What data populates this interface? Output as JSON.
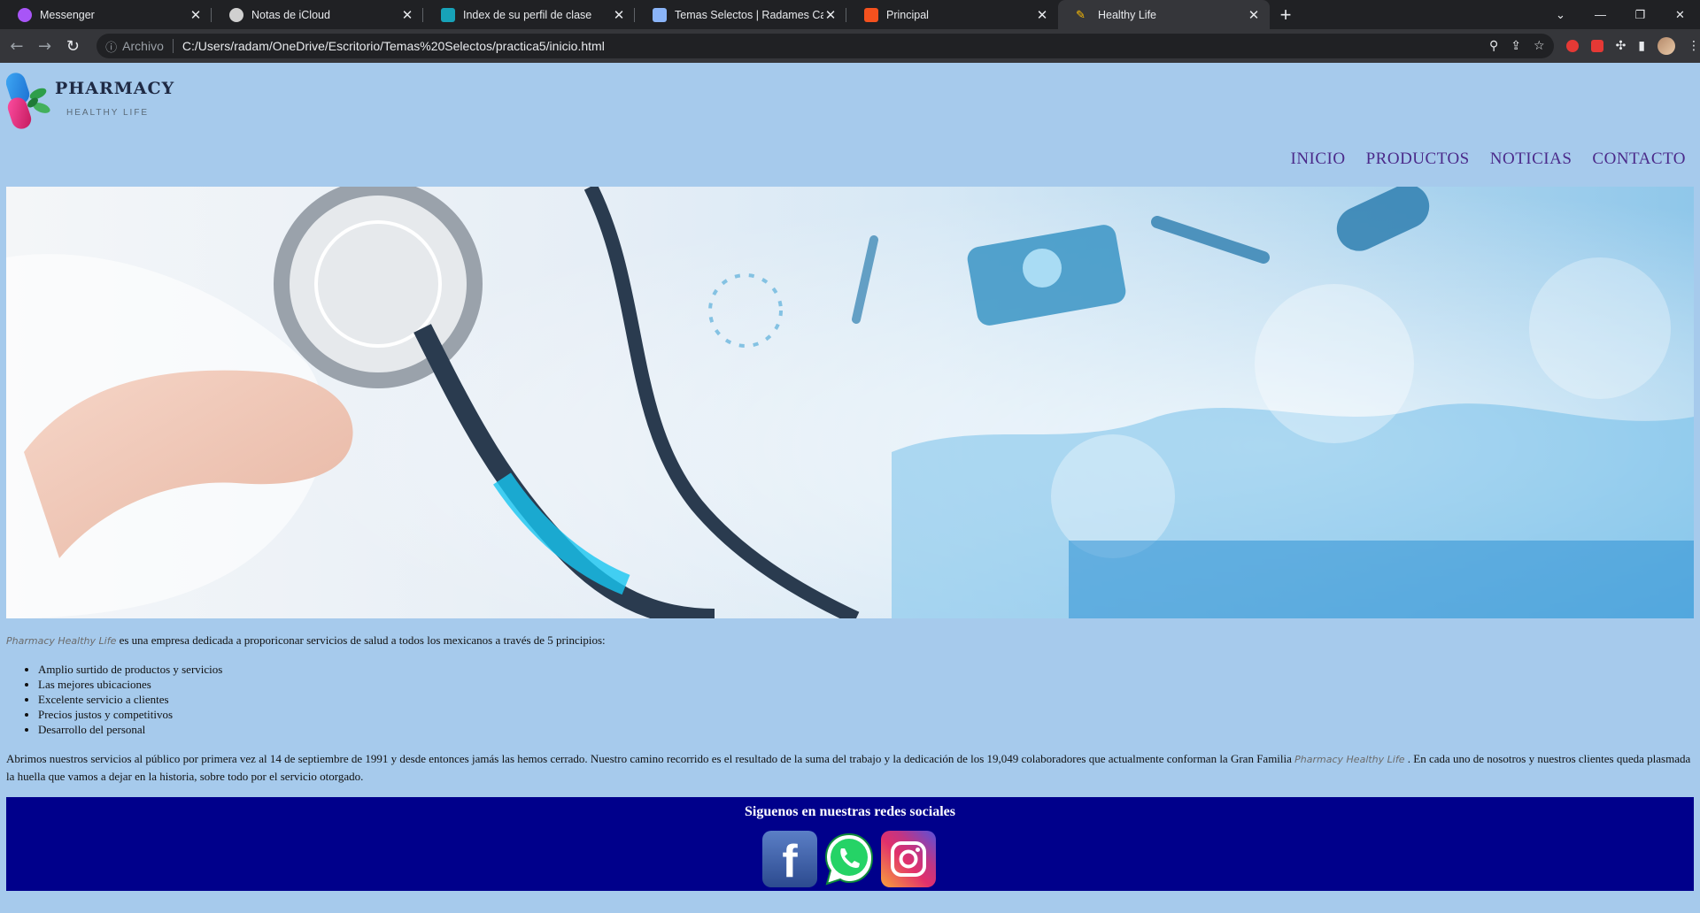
{
  "browser": {
    "tabs": [
      {
        "title": "Messenger",
        "favicon_color": "#a855f7"
      },
      {
        "title": "Notas de iCloud",
        "favicon_color": "#d0d0d0"
      },
      {
        "title": "Index de su perfil de clase",
        "favicon_color": "#17a2b8"
      },
      {
        "title": "Temas Selectos | Radames Castro",
        "favicon_color": "#8ab4f8"
      },
      {
        "title": "Principal",
        "favicon_color": "#f4511e"
      },
      {
        "title": "Healthy Life",
        "favicon_color": "#fbbc04",
        "active": true
      }
    ],
    "address": {
      "security_label": "Archivo",
      "url": "C:/Users/radam/OneDrive/Escritorio/Temas%20Selectos/practica5/inicio.html"
    }
  },
  "logo": {
    "title": "PHARMACY",
    "subtitle": "HEALTHY LIFE"
  },
  "nav": {
    "items": [
      "INICIO",
      "PRODUCTOS",
      "NOTICIAS",
      "CONTACTO"
    ]
  },
  "content": {
    "brand": "Pharmacy Healthy Life",
    "intro": " es una empresa dedicada a proporiconar servicios de salud a todos los mexicanos a través de 5 principios:",
    "principles": [
      "Amplio surtido de productos y servicios",
      "Las mejores ubicaciones",
      "Excelente servicio a clientes",
      "Precios justos y competitivos",
      "Desarrollo del personal"
    ],
    "history_part1": "Abrimos nuestros servicios al público por primera vez al 14 de septiembre de 1991 y desde entonces jamás las hemos cerrado. Nuestro camino recorrido es el resultado de la suma del trabajo y la dedicación de los 19,049 colaboradores que actualmente conforman la Gran Familia ",
    "history_part2": " . En cada uno de nosotros y nuestros clientes queda plasmada la huella que vamos a dejar en la historia, sobre todo por el servicio otorgado."
  },
  "footer": {
    "title": "Siguenos en nuestras redes sociales",
    "social": [
      "facebook-icon",
      "whatsapp-icon",
      "instagram-icon"
    ]
  },
  "colors": {
    "page_bg": "#a6caec",
    "nav_text": "#4b2a8a",
    "footer_bg": "#00008b"
  }
}
